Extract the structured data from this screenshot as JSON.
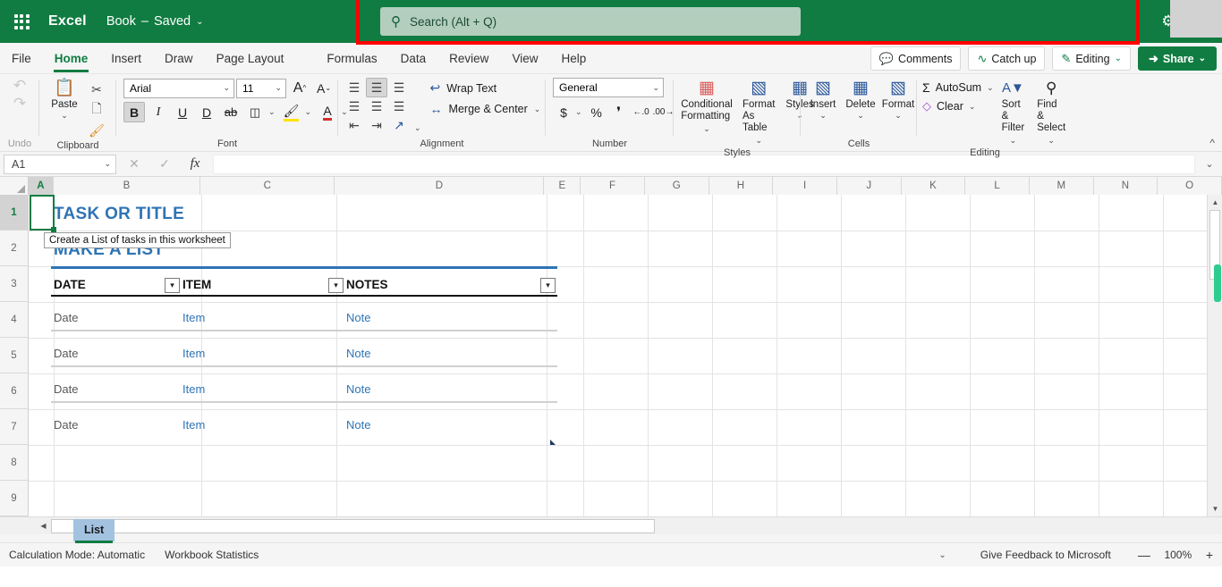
{
  "titlebar": {
    "app_name": "Excel",
    "doc_title": "Book",
    "doc_state": "Saved",
    "doc_separator": "–",
    "caret": "⌄",
    "waffle_icon": "app-launcher-icon",
    "search": {
      "placeholder": "Search (Alt + Q)",
      "icon": "search-icon"
    },
    "settings_icon": "gear-icon"
  },
  "tabs": [
    {
      "label": "File",
      "active": false
    },
    {
      "label": "Home",
      "active": true
    },
    {
      "label": "Insert",
      "active": false
    },
    {
      "label": "Draw",
      "active": false
    },
    {
      "label": "Page Layout",
      "active": false
    },
    {
      "label": "Formulas",
      "active": false
    },
    {
      "label": "Data",
      "active": false
    },
    {
      "label": "Review",
      "active": false
    },
    {
      "label": "View",
      "active": false
    },
    {
      "label": "Help",
      "active": false
    }
  ],
  "tabbar_actions": {
    "comments": "Comments",
    "catch_up": "Catch up",
    "editing": "Editing",
    "editing_caret": "⌄",
    "share": "Share",
    "share_caret": "⌄"
  },
  "ribbon": {
    "groups": {
      "undo": {
        "caption": "Undo",
        "undo_label": "Undo",
        "redo_label": "Redo"
      },
      "clipboard": {
        "caption": "Clipboard",
        "paste": "Paste",
        "paste_caret": "⌄",
        "cut": "Cut",
        "copy": "Copy",
        "format_painter": "Format Painter"
      },
      "font": {
        "caption": "Font",
        "font_name": "Arial",
        "font_size": "11",
        "grow_font": "Increase Font Size",
        "shrink_font": "Decrease Font Size",
        "bold": "B",
        "italic": "I",
        "underline": "U",
        "double_underline": "D",
        "strikethrough": "ab",
        "borders": "Borders",
        "fill_color": "Fill Color",
        "font_color": "Font Color",
        "caret": "⌄"
      },
      "alignment": {
        "caption": "Alignment",
        "wrap_text": "Wrap Text",
        "merge_center": "Merge & Center",
        "merge_caret": "⌄",
        "indent_caret": "⌄"
      },
      "number": {
        "caption": "Number",
        "format": "General",
        "currency": "$",
        "percent": "%",
        "comma": "❜",
        "increase_decimal": "Increase Decimal",
        "decrease_decimal": "Decrease Decimal",
        "caret": "⌄"
      },
      "styles": {
        "caption": "Styles",
        "conditional_formatting": "Conditional Formatting",
        "format_as_table": "Format As Table",
        "cell_styles": "Styles",
        "caret": "⌄"
      },
      "cells": {
        "caption": "Cells",
        "insert": "Insert",
        "delete": "Delete",
        "format": "Format",
        "caret": "⌄"
      },
      "editing": {
        "caption": "Editing",
        "autosum": "AutoSum",
        "clear": "Clear",
        "sort_filter": "Sort & Filter",
        "find_select": "Find & Select",
        "caret": "⌄"
      }
    },
    "collapse_icon": "chevron-up-icon"
  },
  "formula_bar": {
    "name_box": "A1",
    "name_box_caret": "⌄",
    "cancel_icon": "✕",
    "enter_icon": "✓",
    "function_icon": "fx",
    "value": "",
    "expand_caret": "⌄"
  },
  "grid": {
    "columns": [
      "A",
      "B",
      "C",
      "D",
      "E",
      "F",
      "G",
      "H",
      "I",
      "J",
      "K",
      "L",
      "M",
      "N",
      "O"
    ],
    "selected_column": "A",
    "rows": [
      "1",
      "2",
      "3",
      "4",
      "5",
      "6",
      "7",
      "8",
      "9"
    ],
    "selected_row": "1",
    "selected_cell": "A1",
    "tooltip": "Create a List of tasks in this worksheet",
    "template": {
      "title": "TASK OR TITLE",
      "subtitle": "MAKE A LIST",
      "headers": [
        "DATE",
        "ITEM",
        "NOTES"
      ],
      "rows": [
        {
          "date": "Date",
          "item": "Item",
          "note": "Note"
        },
        {
          "date": "Date",
          "item": "Item",
          "note": "Note"
        },
        {
          "date": "Date",
          "item": "Item",
          "note": "Note"
        },
        {
          "date": "Date",
          "item": "Item",
          "note": "Note"
        }
      ]
    }
  },
  "sheet_bar": {
    "prev": "‹",
    "next": "›",
    "all_sheets_icon": "sheet-list-icon",
    "tabs": [
      {
        "label": "List",
        "active": true
      }
    ],
    "add": "+"
  },
  "status_bar": {
    "calculation_mode": "Calculation Mode: Automatic",
    "workbook_statistics": "Workbook Statistics",
    "caret": "⌄",
    "feedback": "Give Feedback to Microsoft",
    "zoom_out": "—",
    "zoom_level": "100%",
    "zoom_in": "+"
  },
  "colors": {
    "excel_green": "#107C41",
    "search_bg": "#B4CEBE",
    "annotation_red": "#FF0000",
    "template_blue": "#2E74B5",
    "sheet_tab_active": "#A3C2E0",
    "scroll_marker_green": "#2ECC8F"
  }
}
